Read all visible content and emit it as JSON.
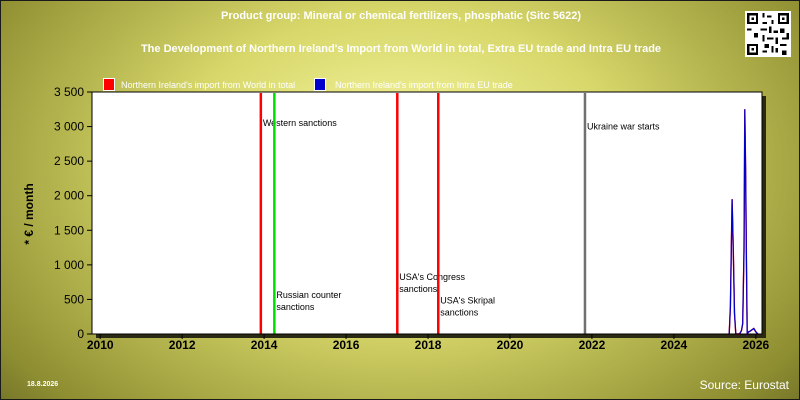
{
  "header": {
    "title": "Product group: Mineral or chemical fertilizers, phosphatic (Sitc 5622)",
    "subtitle": "The Development of Northern Ireland's Import from World in total, Extra EU trade and Intra EU trade"
  },
  "footer": {
    "date": "18.8.2026",
    "source": "Source: Eurostat"
  },
  "colors": {
    "world": "#ff0000",
    "intra_eu": "#0000cc",
    "western_sanctions": "#00dd00",
    "event_red": "#ff0000",
    "ukraine": "#707070"
  },
  "chart_data": {
    "type": "line",
    "ylabel": "* € / month",
    "xlabel": "",
    "xlim": [
      2009.8,
      2026.15
    ],
    "ylim": [
      0,
      3500
    ],
    "xticks": [
      2010,
      2012,
      2014,
      2016,
      2018,
      2020,
      2022,
      2024,
      2026
    ],
    "yticks": [
      0,
      500,
      1000,
      1500,
      2000,
      2500,
      3000,
      3500
    ],
    "ytick_labels": [
      "0",
      "500",
      "1 000",
      "1 500",
      "2 000",
      "2 500",
      "3 000",
      "3 500"
    ],
    "legend": [
      "Northern Ireland's import from World in total",
      "Northern Ireland's import from Intra EU trade"
    ],
    "grid": false,
    "series": [
      {
        "name": "Northern Ireland's import from Intra EU trade",
        "color": "#0000cc",
        "x": [
          2025.35,
          2025.38,
          2025.42,
          2025.45,
          2025.48,
          2025.51,
          2025.55,
          2025.6,
          2025.65,
          2025.68,
          2025.71,
          2025.73,
          2025.75,
          2025.77,
          2025.79,
          2025.82,
          2025.86,
          2025.9,
          2025.95,
          2026.0,
          2026.05
        ],
        "y": [
          0,
          400,
          1950,
          1200,
          300,
          0,
          0,
          0,
          50,
          150,
          1200,
          3250,
          2400,
          1100,
          0,
          30,
          40,
          60,
          80,
          30,
          0
        ]
      },
      {
        "name": "Northern Ireland's import from World in total",
        "color": "#ff0000",
        "x": [
          2025.35,
          2025.38,
          2025.42,
          2025.45,
          2025.48,
          2025.51,
          2025.55,
          2025.6,
          2025.65,
          2025.68,
          2025.71,
          2025.73,
          2025.75,
          2025.77,
          2025.79,
          2025.82,
          2025.86,
          2025.9,
          2025.95,
          2026.0,
          2026.05
        ],
        "y": [
          0,
          400,
          1950,
          1200,
          300,
          0,
          0,
          0,
          50,
          150,
          1200,
          3250,
          2400,
          1100,
          0,
          30,
          40,
          60,
          80,
          30,
          0
        ]
      }
    ],
    "events": [
      {
        "x": 2013.92,
        "color": "#ff0000",
        "label": "Western sanctions",
        "label_y": 3010
      },
      {
        "x": 2014.25,
        "color": "#00dd00",
        "label": "Russian counter sanctions",
        "label_y": 520
      },
      {
        "x": 2017.25,
        "color": "#ff0000",
        "label": "USA's Congress sanctions",
        "label_y": 780
      },
      {
        "x": 2018.25,
        "color": "#ff0000",
        "label": "USA's Skripal sanctions",
        "label_y": 440
      },
      {
        "x": 2021.83,
        "color": "#707070",
        "label": "Ukraine war starts",
        "label_y": 2960
      }
    ]
  }
}
